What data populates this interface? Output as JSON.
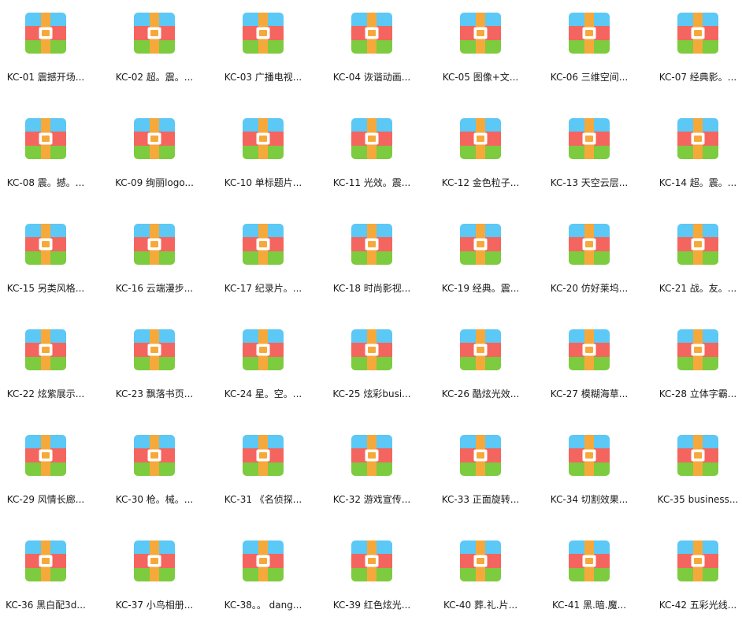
{
  "explorer": {
    "icon_name": "archive-icon",
    "icon_colors": {
      "top": "#5BC8F5",
      "middle": "#F4655F",
      "bottom": "#7DCB3E",
      "strap": "#F6A93B",
      "buckle_fill": "#FFFFFF",
      "buckle_center": "#F6A93B"
    },
    "files": [
      "KC-01 震撼开场...",
      "KC-02 超。震。...",
      "KC-03 广播电视...",
      "KC-04 诙谐动画...",
      "KC-05 图像+文...",
      "KC-06 三维空间...",
      "KC-07 经典影。...",
      "KC-08 震。撼。...",
      "KC-09 绚丽logo...",
      "KC-10 单标题片...",
      "KC-11 光效。震...",
      "KC-12 金色粒子...",
      "KC-13 天空云层...",
      "KC-14 超。震。...",
      "KC-15 另类风格...",
      "KC-16 云端漫步...",
      "KC-17 纪录片。...",
      "KC-18 时尚影视...",
      "KC-19 经典。震...",
      "KC-20 仿好莱坞...",
      "KC-21 战。友。...",
      "KC-22 炫紫展示...",
      "KC-23 飘落书页...",
      "KC-24 星。空。...",
      "KC-25 炫彩busi...",
      "KC-26 酷炫光效...",
      "KC-27 模糊海草...",
      "KC-28 立体字霸...",
      "KC-29 风情长廊...",
      "KC-30 枪。械。...",
      "KC-31 《名侦探...",
      "KC-32 游戏宣传...",
      "KC-33 正面旋转...",
      "KC-34 切割效果...",
      "KC-35 business...",
      "KC-36 黑白配3d...",
      "KC-37 小鸟相册...",
      "KC-38。。 dang...",
      "KC-39 红色炫光...",
      "KC-40 葬.礼.片...",
      "KC-41 黑.暗.魔...",
      "KC-42 五彩光线..."
    ]
  }
}
